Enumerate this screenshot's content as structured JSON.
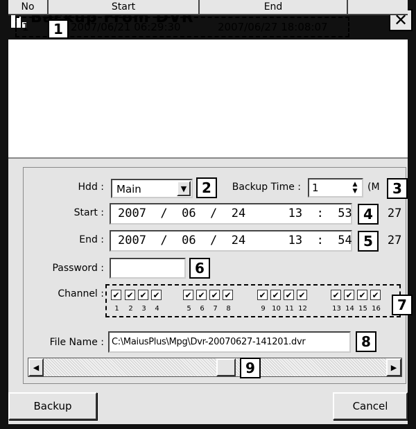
{
  "window": {
    "title": "Backup From DVR",
    "close_glyph": "✕"
  },
  "list": {
    "columns": [
      "No",
      "Start",
      "End"
    ],
    "rows": [
      {
        "no": "1",
        "start": "2007/06/21  06:29:30",
        "end": "2007/06/27  18:08:07"
      }
    ]
  },
  "form": {
    "hdd_label": "Hdd :",
    "hdd_value": "Main",
    "backup_time_label": "Backup Time :",
    "backup_time_value": "1",
    "backup_time_unit": "(M",
    "start_label": "Start :",
    "start_value": "2007  /  06  /  24      13  :  53  :  27",
    "end_label": "End :",
    "end_value": "2007  /  06  /  24      13  :  54  :  27",
    "password_label": "Password :",
    "password_value": "",
    "channel_label": "Channel :",
    "channels": [
      "1",
      "2",
      "3",
      "4",
      "5",
      "6",
      "7",
      "8",
      "9",
      "10",
      "11",
      "12",
      "13",
      "14",
      "15",
      "16"
    ],
    "channel_checked": [
      true,
      true,
      true,
      true,
      true,
      true,
      true,
      true,
      true,
      true,
      true,
      true,
      true,
      true,
      true,
      true
    ],
    "file_name_label": "File Name :",
    "file_name_value": "C:\\MaiusPlus\\Mpg\\Dvr-20070627-141201.dvr"
  },
  "callouts": [
    "1",
    "2",
    "3",
    "4",
    "5",
    "6",
    "7",
    "8",
    "9"
  ],
  "buttons": {
    "backup": "Backup",
    "cancel": "Cancel"
  },
  "glyphs": {
    "dropdown": "▼",
    "spin_up": "▲",
    "spin_down": "▼",
    "check": "✔",
    "scroll_left": "◀",
    "scroll_right": "▶"
  }
}
